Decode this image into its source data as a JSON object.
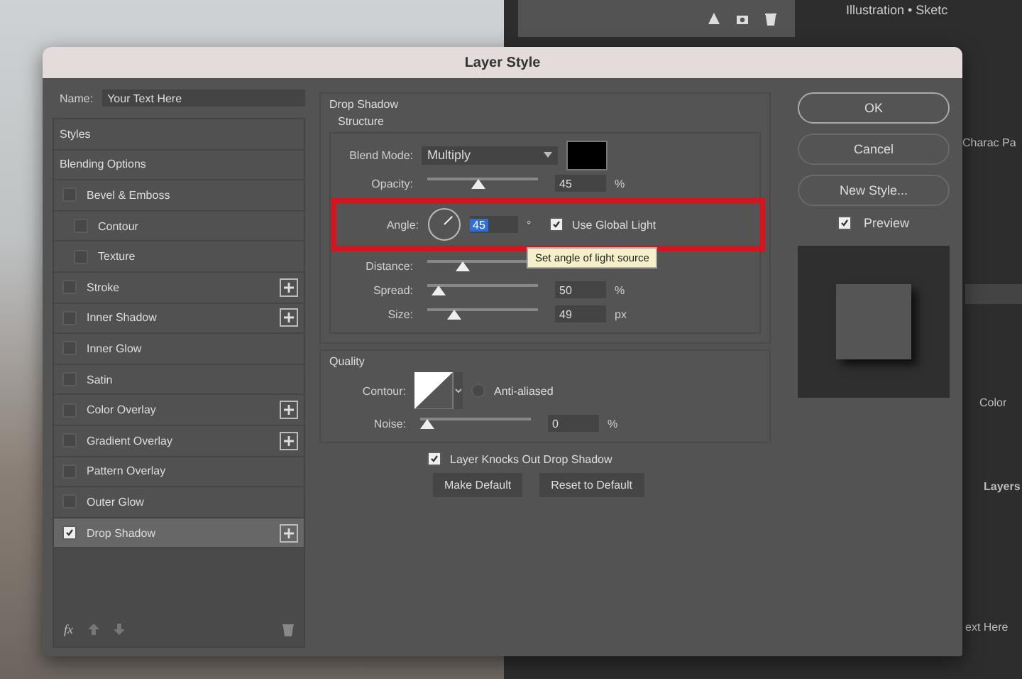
{
  "backdrop": {
    "document_tab": "Illustration • Sketc",
    "panel_tabs": [
      "Charac",
      "Pa"
    ],
    "color_label": "Color",
    "layers_tab": "Layers",
    "layer_name": "ext Here"
  },
  "dialog": {
    "title": "Layer Style",
    "name_label": "Name:",
    "name_value": "Your Text Here"
  },
  "styles": [
    {
      "label": "Styles",
      "kind": "header",
      "selected": false
    },
    {
      "label": "Blending Options",
      "kind": "header",
      "selected": false
    },
    {
      "label": "Bevel & Emboss",
      "kind": "effect",
      "checked": false,
      "add": false,
      "selected": false
    },
    {
      "label": "Contour",
      "kind": "sub",
      "checked": false,
      "add": false,
      "selected": false
    },
    {
      "label": "Texture",
      "kind": "sub",
      "checked": false,
      "add": false,
      "selected": false
    },
    {
      "label": "Stroke",
      "kind": "effect",
      "checked": false,
      "add": true,
      "selected": false
    },
    {
      "label": "Inner Shadow",
      "kind": "effect",
      "checked": false,
      "add": true,
      "selected": false
    },
    {
      "label": "Inner Glow",
      "kind": "effect",
      "checked": false,
      "add": false,
      "selected": false
    },
    {
      "label": "Satin",
      "kind": "effect",
      "checked": false,
      "add": false,
      "selected": false
    },
    {
      "label": "Color Overlay",
      "kind": "effect",
      "checked": false,
      "add": true,
      "selected": false
    },
    {
      "label": "Gradient Overlay",
      "kind": "effect",
      "checked": false,
      "add": true,
      "selected": false
    },
    {
      "label": "Pattern Overlay",
      "kind": "effect",
      "checked": false,
      "add": false,
      "selected": false
    },
    {
      "label": "Outer Glow",
      "kind": "effect",
      "checked": false,
      "add": false,
      "selected": false
    },
    {
      "label": "Drop Shadow",
      "kind": "effect",
      "checked": true,
      "add": true,
      "selected": true
    }
  ],
  "list_footer": {
    "fx": "fx"
  },
  "drop_shadow": {
    "title": "Drop Shadow",
    "structure_title": "Structure",
    "blend_label": "Blend Mode:",
    "blend_value": "Multiply",
    "rows": [
      {
        "kind": "slider",
        "label": "Opacity:",
        "level": 0.45,
        "value": "45",
        "unit": "%"
      },
      {
        "kind": "angle",
        "label": "Angle:",
        "value": "45",
        "unit": "°",
        "global_light": "Use Global Light",
        "checked": true,
        "highlighted": true
      },
      {
        "kind": "slider",
        "label": "Distance:",
        "level": 0.3
      },
      {
        "kind": "slider",
        "label": "Spread:",
        "level": 0.05,
        "value": "50",
        "unit": "%"
      },
      {
        "kind": "slider",
        "label": "Size:",
        "level": 0.2,
        "value": "49",
        "unit": "px"
      }
    ],
    "tooltip": "Set angle of light source",
    "quality_title": "Quality",
    "contour_label": "Contour:",
    "anti_aliased": "Anti-aliased",
    "anti_aliased_checked": false,
    "noise": {
      "label": "Noise:",
      "level": 0,
      "value": "0",
      "unit": "%"
    },
    "knockout": "Layer Knocks Out Drop Shadow",
    "knockout_checked": true,
    "buttons": [
      "Make Default",
      "Reset to Default"
    ]
  },
  "actions": [
    {
      "label": "OK",
      "selected": true
    },
    {
      "label": "Cancel",
      "selected": false
    },
    {
      "label": "New Style...",
      "selected": false
    }
  ],
  "preview": {
    "label": "Preview",
    "checked": true
  }
}
